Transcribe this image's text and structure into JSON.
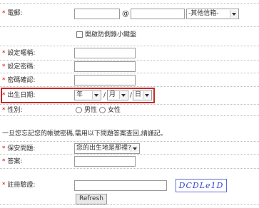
{
  "form": {
    "email": {
      "required_mark": "*",
      "label": "電郵:",
      "at_sign": "@",
      "domain_select": "-其他信箱-"
    },
    "keyboard_checkbox": {
      "label": "開啟防側錄小鍵盤",
      "checked": false
    },
    "username": {
      "required_mark": "*",
      "label": "設定暱稱:"
    },
    "password": {
      "required_mark": "*",
      "label": "設定密碼:"
    },
    "confirm_password": {
      "required_mark": "*",
      "label": "密碼確認:"
    },
    "birthdate": {
      "required_mark": "*",
      "label": "出生日期:",
      "year": "年",
      "sep1": "/",
      "month": "月",
      "sep2": "/",
      "day": "日"
    },
    "gender": {
      "required_mark": "*",
      "label": "性別:",
      "male": "男性",
      "female": "女性"
    },
    "security_note": "一旦您忘記您的帳號密碼,需用以下問題答案查回,請謹記。",
    "security_question": {
      "required_mark": "*",
      "label": "保安問題:",
      "selected": "您的出生地是那裡?"
    },
    "answer": {
      "required_mark": "*",
      "label": "答案:"
    },
    "captcha": {
      "required_mark": "*",
      "label": "註冊驗證:",
      "image_text": "DCDLe1D",
      "refresh_label": "Refresh"
    }
  },
  "colors": {
    "required": "#d40000",
    "highlight": "#c62828",
    "captcha": "#3845c8"
  }
}
